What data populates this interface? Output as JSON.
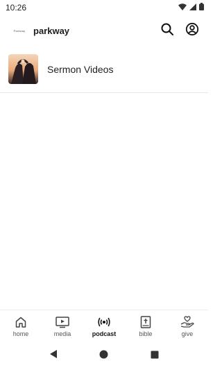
{
  "status_bar": {
    "time": "10:26"
  },
  "app_bar": {
    "logo_text": "Parkway",
    "title": "parkway",
    "icons": [
      "search-icon",
      "account-icon"
    ]
  },
  "content": {
    "items": [
      {
        "title": "Sermon Videos",
        "thumbnail": "sermon-thumbnail"
      }
    ]
  },
  "bottom_nav": {
    "active": "podcast",
    "items": [
      {
        "label": "home",
        "icon": "home-icon"
      },
      {
        "label": "media",
        "icon": "media-icon"
      },
      {
        "label": "podcast",
        "icon": "podcast-icon"
      },
      {
        "label": "bible",
        "icon": "bible-icon"
      },
      {
        "label": "give",
        "icon": "give-icon"
      }
    ]
  },
  "colors": {
    "text": "#1f1f1f",
    "divider": "#e6e6e6",
    "nav_inactive": "#555555"
  }
}
